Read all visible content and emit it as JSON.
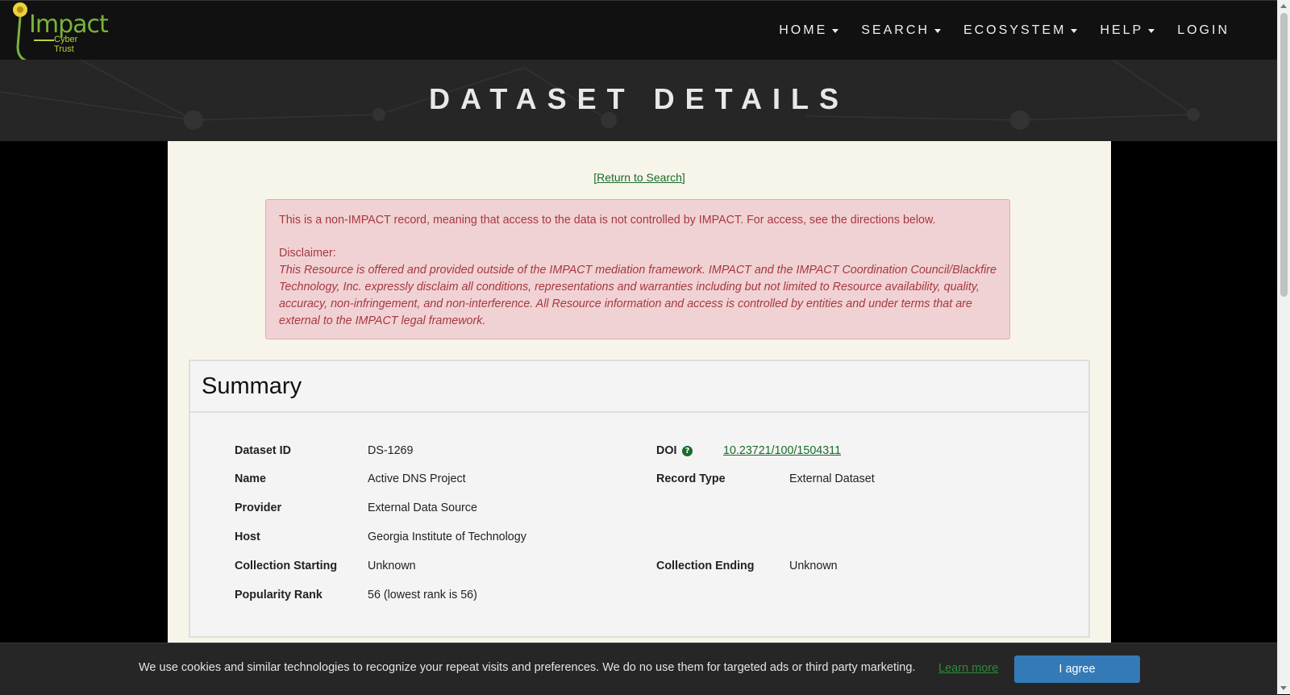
{
  "logo": {
    "name": "Impact",
    "tagline": "Cyber Trust"
  },
  "nav": {
    "items": [
      {
        "label": "HOME",
        "dropdown": true
      },
      {
        "label": "SEARCH",
        "dropdown": true
      },
      {
        "label": "ECOSYSTEM",
        "dropdown": true
      },
      {
        "label": "HELP",
        "dropdown": true
      },
      {
        "label": "LOGIN",
        "dropdown": false
      }
    ]
  },
  "page": {
    "title": "DATASET DETAILS",
    "return_link": "[Return to Search]"
  },
  "alert": {
    "notice": "This is a non-IMPACT record, meaning that access to the data is not controlled by IMPACT. For access, see the directions below.",
    "disclaimer_label": "Disclaimer:",
    "disclaimer_text": "This Resource is offered and provided outside of the IMPACT mediation framework. IMPACT and the IMPACT Coordination Council/Blackfire Technology, Inc. expressly disclaim all conditions, representations and warranties including but not limited to Resource availability, quality, accuracy, non-infringement, and non-interference. All Resource information and access is controlled by entities and under terms that are external to the IMPACT legal framework."
  },
  "summary": {
    "heading": "Summary",
    "dataset_id": {
      "label": "Dataset ID",
      "value": "DS-1269"
    },
    "doi": {
      "label": "DOI",
      "value": "10.23721/100/1504311",
      "help_icon": "question-circle-icon"
    },
    "name": {
      "label": "Name",
      "value": "Active DNS Project"
    },
    "record_type": {
      "label": "Record Type",
      "value": "External Dataset"
    },
    "provider": {
      "label": "Provider",
      "value": "External Data Source"
    },
    "host": {
      "label": "Host",
      "value": "Georgia Institute of Technology"
    },
    "collection_starting": {
      "label": "Collection Starting",
      "value": "Unknown"
    },
    "collection_ending": {
      "label": "Collection Ending",
      "value": "Unknown"
    },
    "popularity_rank": {
      "label": "Popularity Rank",
      "value": "56 (lowest rank is 56)"
    }
  },
  "cookie": {
    "text": "We use cookies and similar technologies to recognize your repeat visits and preferences. We do no use them for targeted ads or third party marketing.",
    "learn_more": "Learn more",
    "agree": "I agree"
  },
  "colors": {
    "navbar": "#111111",
    "banner": "#262626",
    "main_bg": "#f7f5ea",
    "alert_bg": "#f1d2d4",
    "alert_text": "#a6383f",
    "link": "#1a6b2a",
    "button": "#337ab7"
  }
}
